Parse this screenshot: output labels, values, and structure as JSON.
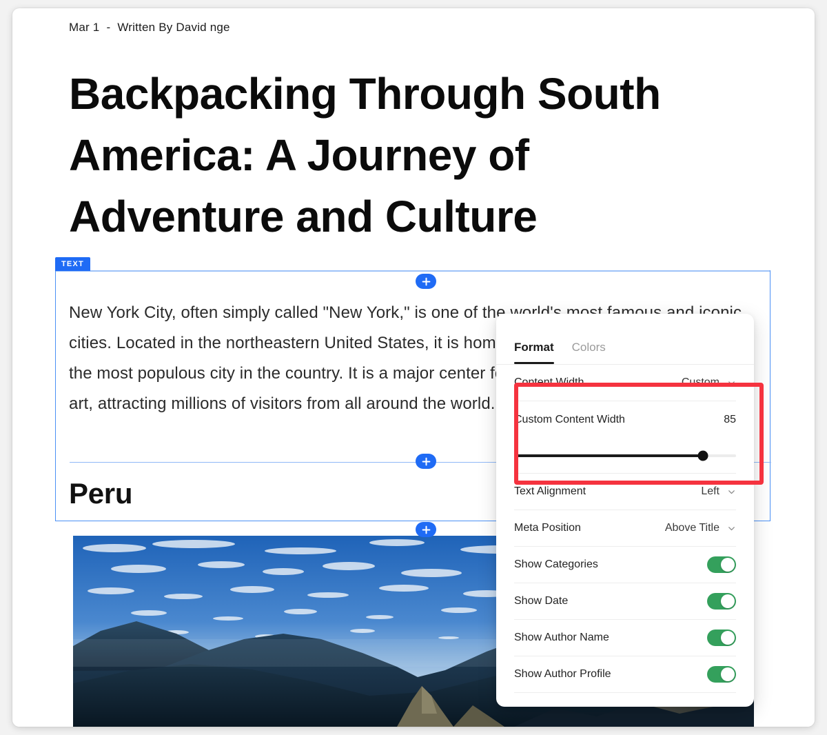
{
  "article": {
    "date": "Mar 1",
    "meta_separator": "-",
    "byline": "Written By David nge",
    "title": "Backpacking Through South America: A Journey of Adventure and Culture",
    "body_paragraph": "New York City, often simply called \"New York,\" is one of the world's most famous and iconic cities. Located in the northeastern United States, it is home to over 8 million people and is the most populous city in the country. It is a major center for finance, culture, media, and art, attracting millions of visitors from all around the world.",
    "section_heading": "Peru"
  },
  "editor": {
    "block_badge": "TEXT",
    "insert_icon": "plus-icon",
    "insert_buttons": [
      "plus-icon",
      "plus-icon",
      "plus-icon"
    ]
  },
  "panel": {
    "tabs": [
      {
        "label": "Format",
        "active": true
      },
      {
        "label": "Colors",
        "active": false
      }
    ],
    "settings": [
      {
        "label": "Content Width",
        "type": "select",
        "value": "Custom",
        "icon": "chevron-down-icon",
        "highlighted": true
      },
      {
        "label": "Custom Content Width",
        "type": "number",
        "value": "85",
        "highlighted": true
      },
      {
        "label": "Content Width Slider",
        "type": "slider",
        "value": 85,
        "min": 0,
        "max": 100,
        "highlighted": true
      },
      {
        "label": "Text Alignment",
        "type": "select",
        "value": "Left",
        "icon": "chevron-down-icon"
      },
      {
        "label": "Meta Position",
        "type": "select",
        "value": "Above Title",
        "icon": "chevron-down-icon"
      },
      {
        "label": "Show Categories",
        "type": "toggle",
        "value": "on"
      },
      {
        "label": "Show Date",
        "type": "toggle",
        "value": "on"
      },
      {
        "label": "Show Author Name",
        "type": "toggle",
        "value": "on"
      },
      {
        "label": "Show Author Profile",
        "type": "toggle",
        "value": "on"
      }
    ]
  },
  "colors": {
    "accent_blue": "#1f6bf5",
    "selection_border": "#4a90f5",
    "toggle_on_green": "#34a05c",
    "annotation_red": "#f5333f",
    "slider_fill": "#1a1a1a",
    "page_background": "#f2f2f2",
    "card_background": "#ffffff"
  }
}
